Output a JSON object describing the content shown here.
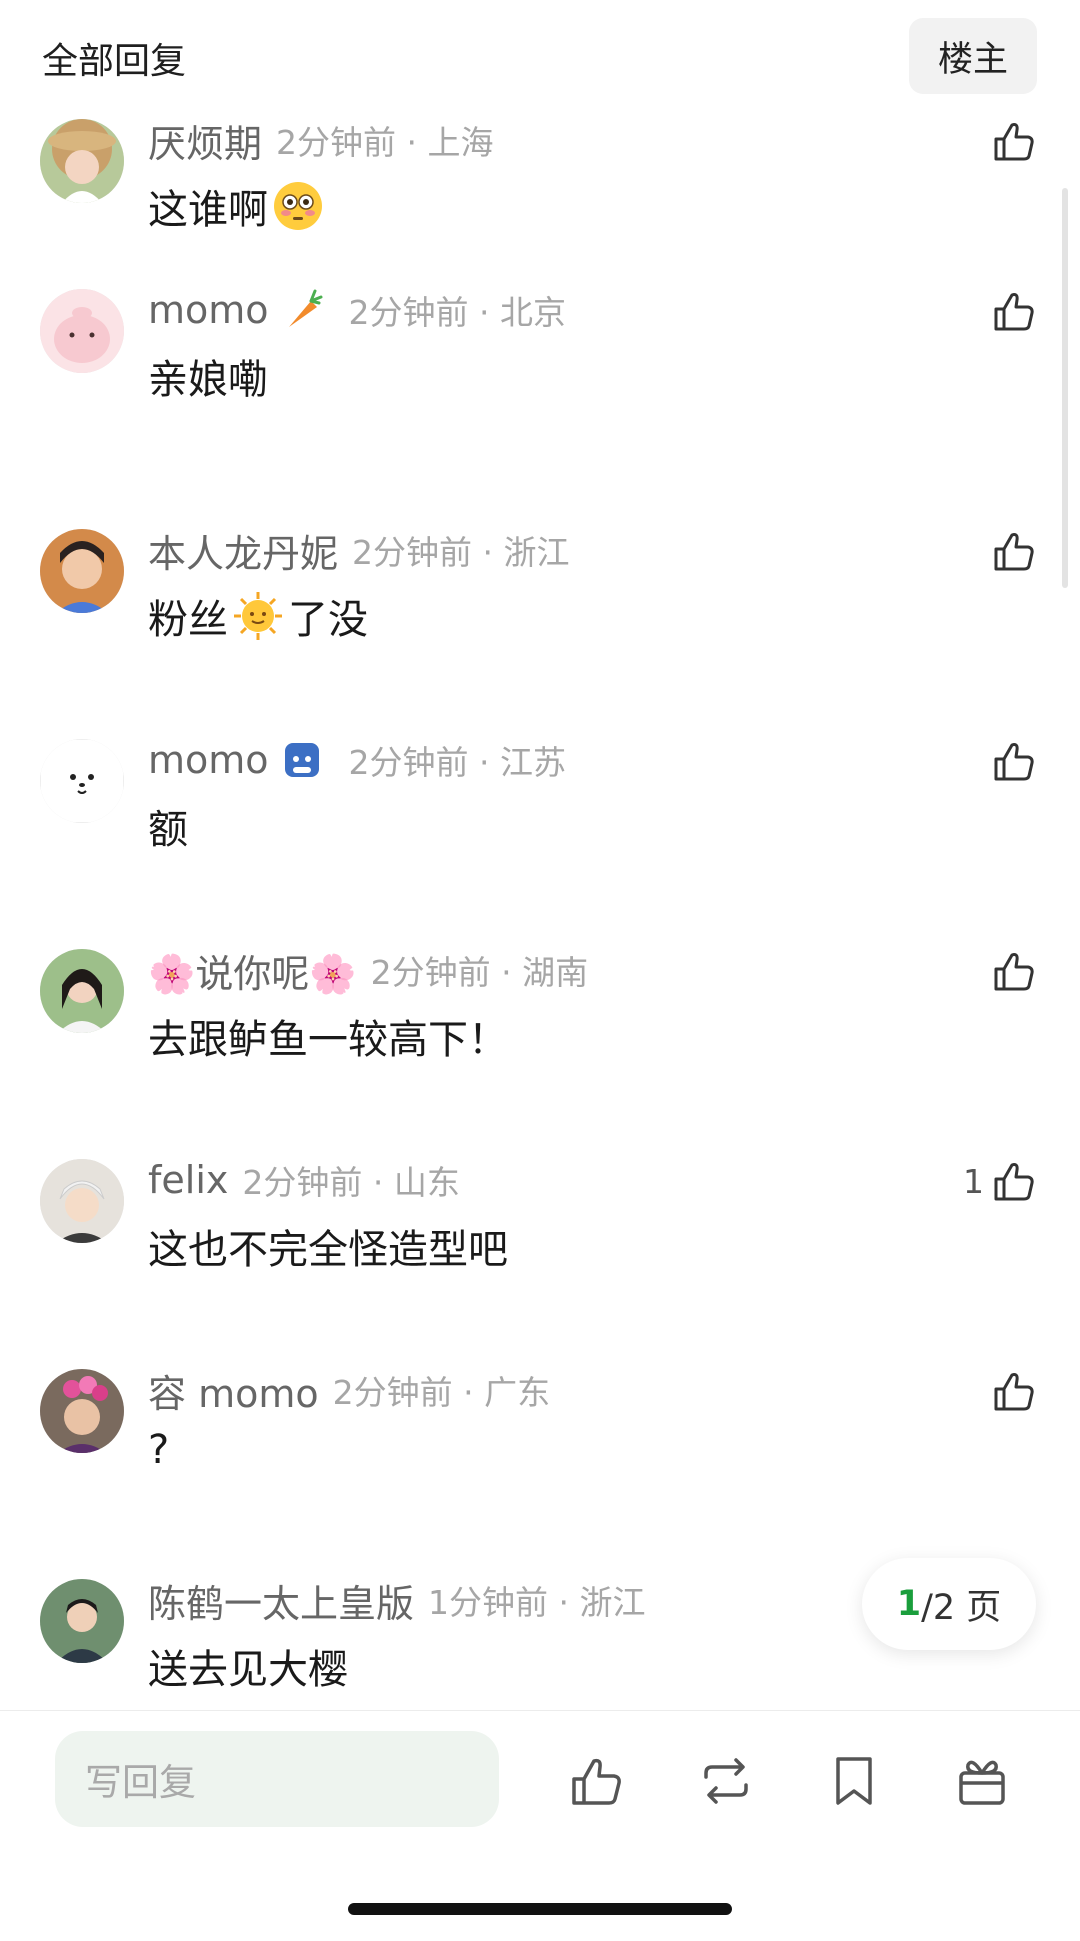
{
  "header": {
    "title": "全部回复",
    "op_filter_label": "楼主"
  },
  "comments": [
    {
      "username": "厌烦期",
      "badge": "",
      "time": "2分钟前 · 上海",
      "text_before": "这谁啊",
      "emoji": "flushed-face-emoji",
      "text_after": "",
      "likes": ""
    },
    {
      "username": "momo",
      "badge": "carrot-badge",
      "time": "2分钟前 · 北京",
      "text_before": "亲娘嘞",
      "emoji": "",
      "text_after": "",
      "likes": ""
    },
    {
      "username": "本人龙丹妮",
      "badge": "",
      "time": "2分钟前 · 浙江",
      "text_before": "粉丝",
      "emoji": "sun-face-emoji",
      "text_after": "了没",
      "likes": ""
    },
    {
      "username": "momo",
      "badge": "cat-badge",
      "time": "2分钟前 · 江苏",
      "text_before": "额",
      "emoji": "",
      "text_after": "",
      "likes": ""
    },
    {
      "username": "🌸说你呢🌸",
      "badge": "",
      "time": "2分钟前 · 湖南",
      "text_before": "去跟鲈鱼一较高下！",
      "emoji": "",
      "text_after": "",
      "likes": ""
    },
    {
      "username": "felix",
      "badge": "",
      "time": "2分钟前 · 山东",
      "text_before": "这也不完全怪造型吧",
      "emoji": "",
      "text_after": "",
      "likes": "1"
    },
    {
      "username": "容 momo",
      "badge": "",
      "time": "2分钟前 · 广东",
      "text_before": "?",
      "emoji": "",
      "text_after": "",
      "likes": ""
    },
    {
      "username": "陈鹤一太上皇版",
      "badge": "",
      "time": "1分钟前 · 浙江",
      "text_before": "送去见大樱",
      "emoji": "",
      "text_after": "",
      "likes": ""
    }
  ],
  "pagination": {
    "current": "1",
    "total_text": "/2 页"
  },
  "bottom_bar": {
    "reply_placeholder": "写回复",
    "icons": [
      "like-icon",
      "repost-icon",
      "bookmark-icon",
      "gift-icon"
    ]
  },
  "colors": {
    "accent_green": "#1a9e3c",
    "meta_gray": "#a6a6a6",
    "input_bg": "#eef4ef"
  }
}
